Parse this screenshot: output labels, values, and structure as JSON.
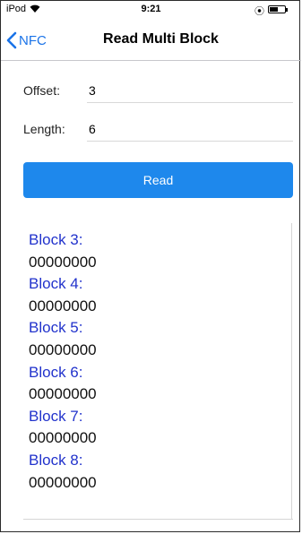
{
  "status": {
    "carrier": "iPod",
    "time": "9:21"
  },
  "nav": {
    "back_label": "NFC",
    "title": "Read Multi Block"
  },
  "form": {
    "offset_label": "Offset:",
    "offset_value": "3",
    "length_label": "Length:",
    "length_value": "6",
    "read_label": "Read"
  },
  "colors": {
    "accent": "#1e88ec",
    "block_label": "#2233cc"
  },
  "blocks": [
    {
      "name": "Block 3:",
      "value": "00000000"
    },
    {
      "name": "Block 4:",
      "value": "00000000"
    },
    {
      "name": "Block 5:",
      "value": "00000000"
    },
    {
      "name": "Block 6:",
      "value": "00000000"
    },
    {
      "name": "Block 7:",
      "value": "00000000"
    },
    {
      "name": "Block 8:",
      "value": "00000000"
    }
  ]
}
